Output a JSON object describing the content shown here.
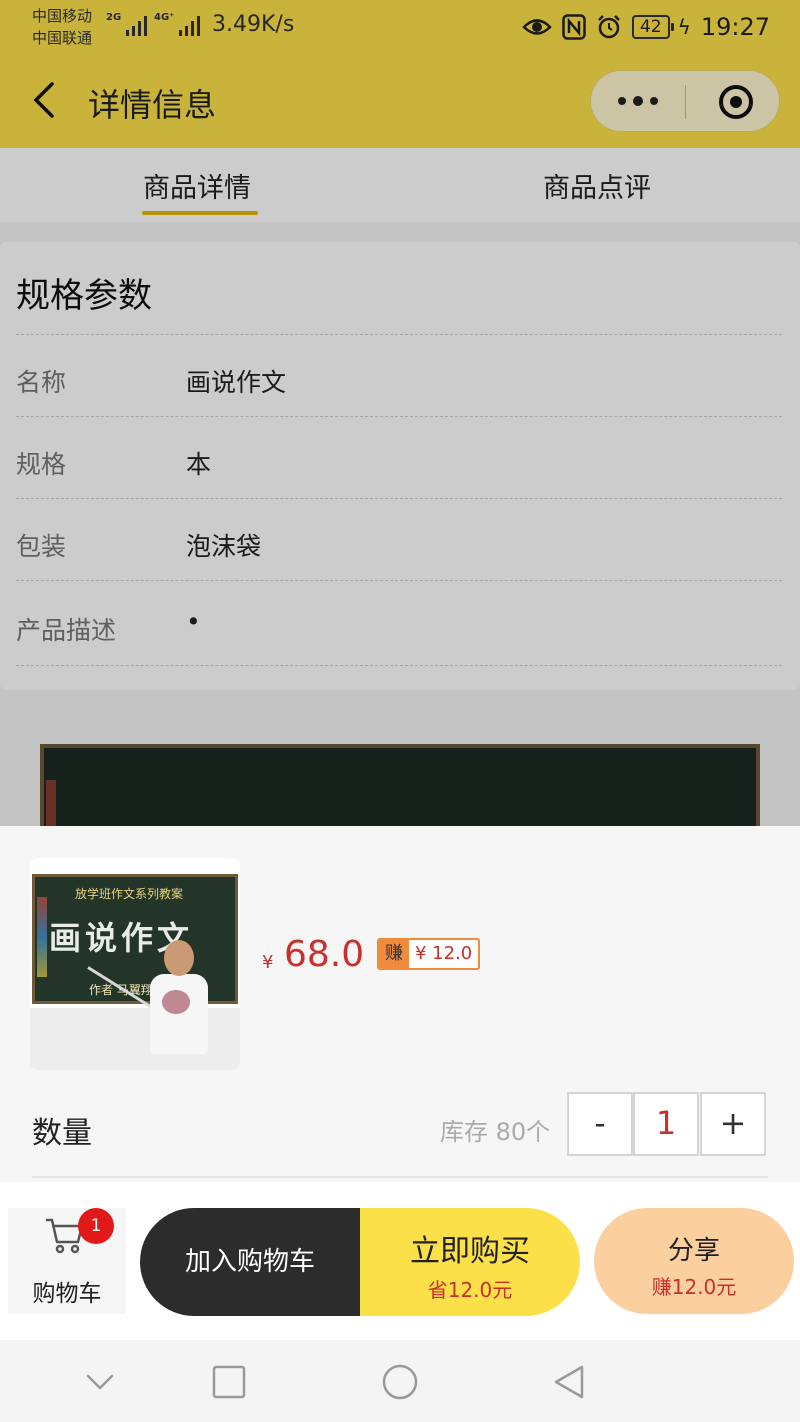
{
  "status_bar": {
    "carrier1": "中国移动",
    "carrier2": "中国联通",
    "net1": "2G",
    "net2": "4G⁺",
    "speed": "3.49K/s",
    "battery": "42",
    "time": "19:27",
    "icons": [
      "eye-icon",
      "nfc-icon",
      "alarm-icon",
      "battery-icon",
      "charging-icon"
    ]
  },
  "nav": {
    "back_icon": "chevron-left-icon",
    "title": "详情信息",
    "more_icon": "more-dots-icon",
    "close_icon": "target-close-icon"
  },
  "tabs": [
    {
      "label": "商品详情",
      "active": true
    },
    {
      "label": "商品点评",
      "active": false
    }
  ],
  "specs": {
    "title": "规格参数",
    "rows": [
      {
        "label": "名称",
        "value": "画说作文"
      },
      {
        "label": "规格",
        "value": "本"
      },
      {
        "label": "包装",
        "value": "泡沫袋"
      },
      {
        "label": "产品描述",
        "value": "•"
      }
    ]
  },
  "product_image": {
    "line1": "放学班作文系列教案",
    "title": "画说作文",
    "author": "作者 马翼翔"
  },
  "sheet": {
    "currency_symbol": "¥",
    "price": "68.0",
    "earn_tag": "赚",
    "earn_amount": "¥ 12.0",
    "qty_label": "数量",
    "stock": "库存  80个",
    "minus": "-",
    "qty": "1",
    "plus": "+"
  },
  "actions": {
    "cart_label": "购物车",
    "cart_badge": "1",
    "cart_icon": "shopping-cart-icon",
    "add_to_cart": "加入购物车",
    "buy_now": "立即购买",
    "buy_save": "省12.0元",
    "share": "分享",
    "share_earn": "赚12.0元"
  },
  "colors": {
    "brand_yellow": "#fce04a",
    "price_red": "#c9302c",
    "earn_orange": "#f08a3c",
    "share_peach": "#fccf9e",
    "dark_button": "#2c2c2c"
  },
  "system_nav": [
    "collapse-chevron-icon",
    "recents-square-icon",
    "home-circle-icon",
    "back-triangle-icon"
  ]
}
